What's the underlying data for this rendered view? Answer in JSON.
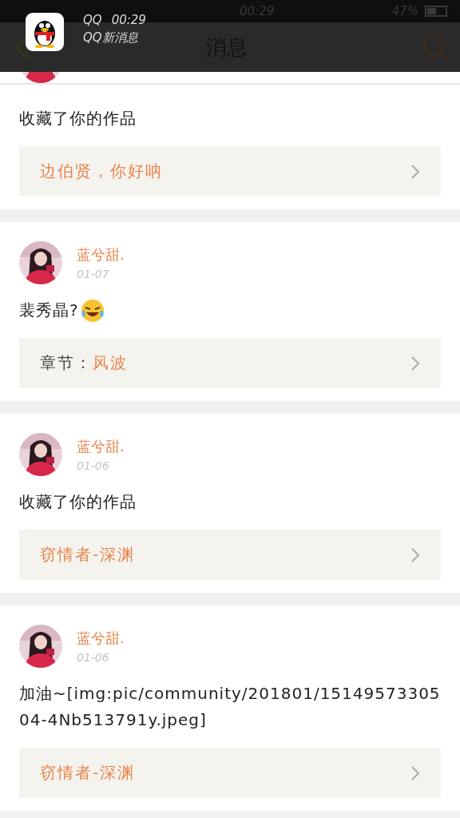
{
  "status_bar": {
    "time": "00:29",
    "battery": "47%"
  },
  "notification": {
    "app": "QQ",
    "time": "00:29",
    "text": "QQ新消息"
  },
  "header": {
    "title": "消息"
  },
  "messages": [
    {
      "text": "收藏了你的作品",
      "link": [
        {
          "kind": "title",
          "text": "边伯贤，你好呐"
        }
      ]
    },
    {
      "name": "蓝兮甜.",
      "date": "01-07",
      "text": "裴秀晶?",
      "emoji": true,
      "link": [
        {
          "kind": "label",
          "text": "章节："
        },
        {
          "kind": "title",
          "text": "风波"
        }
      ]
    },
    {
      "name": "蓝兮甜.",
      "date": "01-06",
      "text": "收藏了你的作品",
      "link": [
        {
          "kind": "title",
          "text": "窃情者-深渊"
        }
      ]
    },
    {
      "name": "蓝兮甜.",
      "date": "01-06",
      "text": "加油~[img:pic/community/201801/1514957330504-4Nb513791y.jpeg]",
      "link": [
        {
          "kind": "title",
          "text": "窃情者-深渊"
        }
      ]
    }
  ]
}
